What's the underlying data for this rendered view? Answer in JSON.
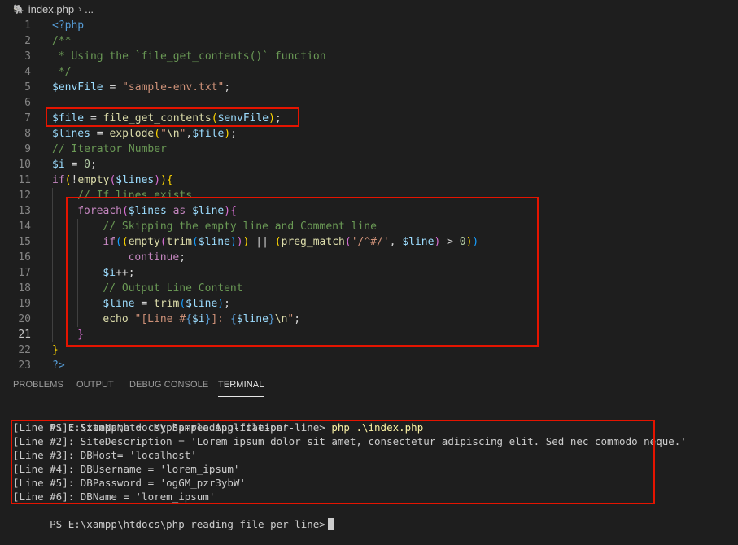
{
  "breadcrumb": {
    "file": "index.php",
    "more": "..."
  },
  "editor": {
    "active_line": 21,
    "lines": [
      {
        "n": "1",
        "indent": 0,
        "t": [
          [
            "kw",
            "<?php"
          ]
        ]
      },
      {
        "n": "2",
        "indent": 0,
        "t": [
          [
            "cm",
            "/**"
          ]
        ]
      },
      {
        "n": "3",
        "indent": 0,
        "t": [
          [
            "cm",
            " * Using the `file_get_contents()` function"
          ]
        ]
      },
      {
        "n": "4",
        "indent": 0,
        "t": [
          [
            "cm",
            " */"
          ]
        ]
      },
      {
        "n": "5",
        "indent": 0,
        "t": [
          [
            "var",
            "$envFile"
          ],
          [
            "p",
            " = "
          ],
          [
            "str",
            "\"sample-env.txt\""
          ],
          [
            "p",
            ";"
          ]
        ]
      },
      {
        "n": "6",
        "indent": 0,
        "t": []
      },
      {
        "n": "7",
        "indent": 0,
        "t": [
          [
            "var",
            "$file"
          ],
          [
            "p",
            " = "
          ],
          [
            "fn",
            "file_get_contents"
          ],
          [
            "b1",
            "("
          ],
          [
            "var",
            "$envFile"
          ],
          [
            "b1",
            ")"
          ],
          [
            "p",
            ";"
          ]
        ]
      },
      {
        "n": "8",
        "indent": 0,
        "t": [
          [
            "var",
            "$lines"
          ],
          [
            "p",
            " = "
          ],
          [
            "fn",
            "explode"
          ],
          [
            "b1",
            "("
          ],
          [
            "str",
            "\""
          ],
          [
            "fn",
            "\\n"
          ],
          [
            "str",
            "\""
          ],
          [
            "p",
            ","
          ],
          [
            "var",
            "$file"
          ],
          [
            "b1",
            ")"
          ],
          [
            "p",
            ";"
          ]
        ]
      },
      {
        "n": "9",
        "indent": 0,
        "t": [
          [
            "cm",
            "// Iterator Number"
          ]
        ]
      },
      {
        "n": "10",
        "indent": 0,
        "t": [
          [
            "var",
            "$i"
          ],
          [
            "p",
            " = "
          ],
          [
            "num",
            "0"
          ],
          [
            "p",
            ";"
          ]
        ]
      },
      {
        "n": "11",
        "indent": 0,
        "t": [
          [
            "ctl",
            "if"
          ],
          [
            "b1",
            "("
          ],
          [
            "p",
            "!"
          ],
          [
            "fn",
            "empty"
          ],
          [
            "b2",
            "("
          ],
          [
            "var",
            "$lines"
          ],
          [
            "b2",
            ")"
          ],
          [
            "b1",
            ")"
          ],
          [
            "b1",
            "{"
          ]
        ]
      },
      {
        "n": "12",
        "indent": 1,
        "t": [
          [
            "cm",
            "// If lines exists"
          ]
        ]
      },
      {
        "n": "13",
        "indent": 1,
        "t": [
          [
            "ctl",
            "foreach"
          ],
          [
            "b2",
            "("
          ],
          [
            "var",
            "$lines"
          ],
          [
            "p",
            " "
          ],
          [
            "ctl",
            "as"
          ],
          [
            "p",
            " "
          ],
          [
            "var",
            "$line"
          ],
          [
            "b2",
            ")"
          ],
          [
            "b2",
            "{"
          ]
        ]
      },
      {
        "n": "14",
        "indent": 2,
        "t": [
          [
            "cm",
            "// Skipping the empty line and Comment line"
          ]
        ]
      },
      {
        "n": "15",
        "indent": 2,
        "t": [
          [
            "ctl",
            "if"
          ],
          [
            "b3",
            "("
          ],
          [
            "b1",
            "("
          ],
          [
            "fn",
            "empty"
          ],
          [
            "b2",
            "("
          ],
          [
            "fn",
            "trim"
          ],
          [
            "b3",
            "("
          ],
          [
            "var",
            "$line"
          ],
          [
            "b3",
            ")"
          ],
          [
            "b2",
            ")"
          ],
          [
            "b1",
            ")"
          ],
          [
            "p",
            " || "
          ],
          [
            "b1",
            "("
          ],
          [
            "fn",
            "preg_match"
          ],
          [
            "b2",
            "("
          ],
          [
            "str",
            "'/^#/'"
          ],
          [
            "p",
            ", "
          ],
          [
            "var",
            "$line"
          ],
          [
            "b2",
            ")"
          ],
          [
            "p",
            " > "
          ],
          [
            "num",
            "0"
          ],
          [
            "b1",
            ")"
          ],
          [
            "b3",
            ")"
          ]
        ]
      },
      {
        "n": "16",
        "indent": 3,
        "t": [
          [
            "ctl",
            "continue"
          ],
          [
            "p",
            ";"
          ]
        ]
      },
      {
        "n": "17",
        "indent": 2,
        "t": [
          [
            "var",
            "$i"
          ],
          [
            "p",
            "++;"
          ]
        ]
      },
      {
        "n": "18",
        "indent": 2,
        "t": [
          [
            "cm",
            "// Output Line Content"
          ]
        ]
      },
      {
        "n": "19",
        "indent": 2,
        "t": [
          [
            "var",
            "$line"
          ],
          [
            "p",
            " = "
          ],
          [
            "fn",
            "trim"
          ],
          [
            "b3",
            "("
          ],
          [
            "var",
            "$line"
          ],
          [
            "b3",
            ")"
          ],
          [
            "p",
            ";"
          ]
        ]
      },
      {
        "n": "20",
        "indent": 2,
        "t": [
          [
            "fn",
            "echo"
          ],
          [
            "p",
            " "
          ],
          [
            "str",
            "\"[Line #"
          ],
          [
            "kw",
            "{"
          ],
          [
            "var",
            "$i"
          ],
          [
            "kw",
            "}"
          ],
          [
            "str",
            "]: "
          ],
          [
            "kw",
            "{"
          ],
          [
            "var",
            "$line"
          ],
          [
            "kw",
            "}"
          ],
          [
            "fn",
            "\\n"
          ],
          [
            "str",
            "\""
          ],
          [
            "p",
            ";"
          ]
        ]
      },
      {
        "n": "21",
        "indent": 1,
        "t": [
          [
            "b2",
            "}"
          ]
        ]
      },
      {
        "n": "22",
        "indent": 0,
        "t": [
          [
            "b1",
            "}"
          ]
        ]
      },
      {
        "n": "23",
        "indent": 0,
        "t": [
          [
            "kw",
            "?>"
          ]
        ]
      }
    ]
  },
  "panel": {
    "tabs": [
      {
        "label": "PROBLEMS",
        "active": false
      },
      {
        "label": "OUTPUT",
        "active": false
      },
      {
        "label": "DEBUG CONSOLE",
        "active": false
      },
      {
        "label": "TERMINAL",
        "active": true
      }
    ]
  },
  "terminal": {
    "prompt": "PS E:\\xampp\\htdocs\\php-reading-file-per-line>",
    "command": " php .\\index.php",
    "output": [
      "[Line #1]: SiteName = 'My Sample Application'",
      "[Line #2]: SiteDescription = 'Lorem ipsum dolor sit amet, consectetur adipiscing elit. Sed nec commodo neque.'",
      "[Line #3]: DBHost= 'localhost'",
      "[Line #4]: DBUsername = 'lorem_ipsum'",
      "[Line #5]: DBPassword = 'ogGM_pzr3ybW'",
      "[Line #6]: DBName = 'lorem_ipsum'"
    ],
    "final_prompt": "PS E:\\xampp\\htdocs\\php-reading-file-per-line>"
  },
  "colors": {
    "background": "#1e1e1e",
    "highlight_box": "#e51400",
    "keyword": "#569cd6",
    "comment": "#6a9955",
    "variable": "#9cdcfe",
    "string": "#ce9178",
    "function": "#dcdcaa",
    "control": "#c586c0"
  }
}
